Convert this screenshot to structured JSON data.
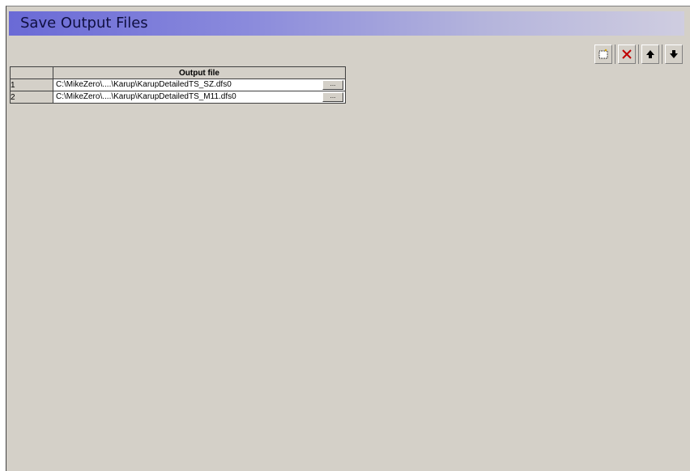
{
  "header": {
    "title": "Save Output Files"
  },
  "toolbar": {
    "buttons": [
      {
        "icon": "new-row-icon"
      },
      {
        "icon": "delete-icon",
        "color": "#c00000"
      },
      {
        "icon": "move-up-icon"
      },
      {
        "icon": "move-down-icon"
      }
    ]
  },
  "table": {
    "column_header": "Output file",
    "rows": [
      {
        "index": "1",
        "path": "C:\\MikeZero\\....\\Karup\\KarupDetailedTS_SZ.dfs0",
        "browse": "..."
      },
      {
        "index": "2",
        "path": "C:\\MikeZero\\....\\Karup\\KarupDetailedTS_M11.dfs0",
        "browse": "..."
      }
    ]
  }
}
